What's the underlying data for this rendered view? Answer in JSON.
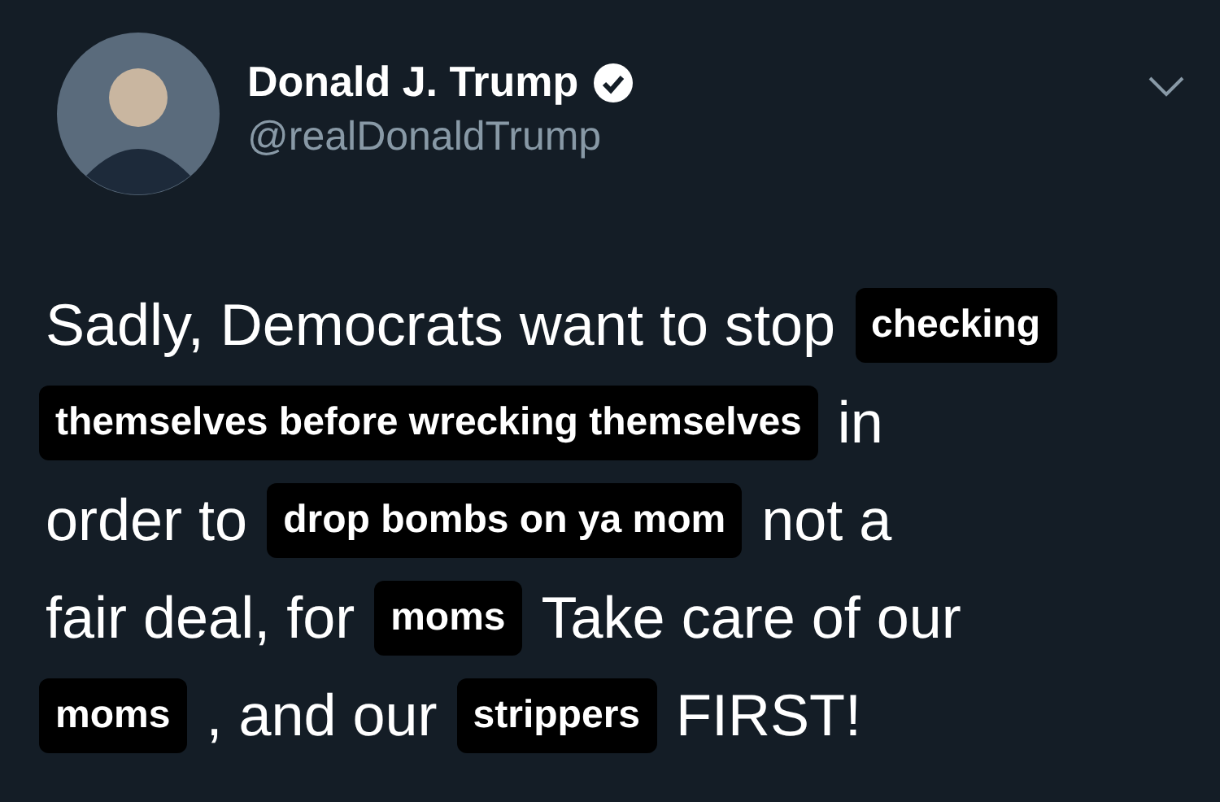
{
  "header": {
    "name": "Donald J. Trump",
    "verified": true,
    "handle": "@realDonaldTrump"
  },
  "lines": [
    {
      "segments": [
        {
          "kind": "text",
          "text": "Sadly, Democrats want to stop"
        },
        {
          "kind": "sticker",
          "text": "checking"
        }
      ]
    },
    {
      "segments": [
        {
          "kind": "sticker",
          "text": "themselves before wrecking themselves"
        },
        {
          "kind": "text",
          "text": "in"
        }
      ]
    },
    {
      "segments": [
        {
          "kind": "text",
          "text": "order to"
        },
        {
          "kind": "sticker",
          "text": "drop bombs on ya mom"
        },
        {
          "kind": "text",
          "text": "not a"
        }
      ]
    },
    {
      "segments": [
        {
          "kind": "text",
          "text": "fair deal, for"
        },
        {
          "kind": "sticker",
          "text": "moms"
        },
        {
          "kind": "text",
          "text": "Take care of our"
        }
      ]
    },
    {
      "segments": [
        {
          "kind": "sticker",
          "text": "moms"
        },
        {
          "kind": "text",
          "text": ", and our"
        },
        {
          "kind": "sticker",
          "text": "strippers"
        },
        {
          "kind": "text",
          "text": "FIRST!"
        }
      ]
    }
  ]
}
